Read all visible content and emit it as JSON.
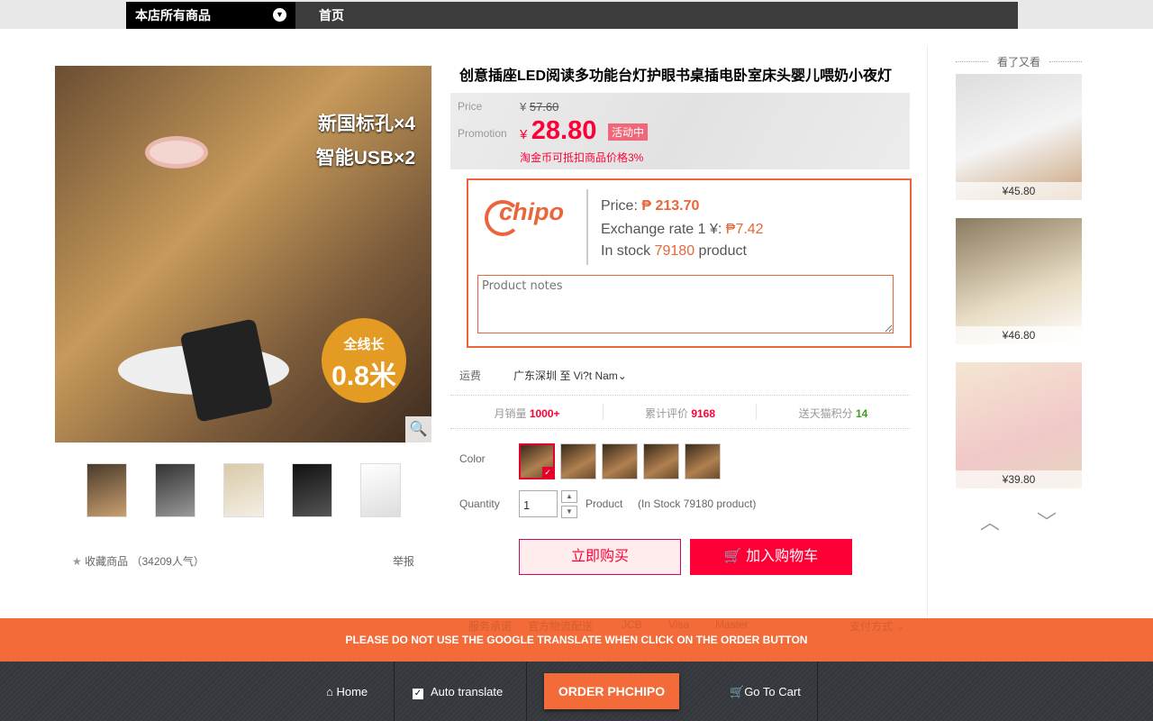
{
  "topnav": {
    "all_products": "本店所有商品",
    "home": "首页"
  },
  "gallery": {
    "overlay_line1": "新国标孔×4",
    "overlay_line2": "智能USB×2",
    "badge_line1": "全线长",
    "badge_line2": "0.8米",
    "thumbnail_count": 5
  },
  "favorite": {
    "label": "收藏商品",
    "popularity": "（34209人气）",
    "report": "举报"
  },
  "product": {
    "title": "创意插座LED阅读多功能台灯护眼书桌插电卧室床头婴儿喂奶小夜灯",
    "price_label": "Price",
    "currency": "¥",
    "original_price": "57.60",
    "promotion_label": "Promotion",
    "promotion_price": "28.80",
    "promo_tag": "活动中",
    "coin_note": "淘金币可抵扣商品价格3%"
  },
  "chipo": {
    "logo": "chipo",
    "price_label": "Price:",
    "price": "₱ 213.70",
    "rate_label": "Exchange rate 1 ¥:",
    "rate": "₱7.42",
    "stock_label": "In stock",
    "stock": "79180",
    "stock_unit": "product",
    "notes_placeholder": "Product notes"
  },
  "shipping": {
    "label": "运费",
    "value": "广东深圳  至 Vi?t Nam⌄"
  },
  "stats": [
    {
      "label": "月销量",
      "value": "1000+"
    },
    {
      "label": "累计评价",
      "value": "9168"
    },
    {
      "label": "送天猫积分",
      "value": "14"
    }
  ],
  "options": {
    "color_label": "Color",
    "color_count": 5,
    "selected_index": 0,
    "quantity_label": "Quantity",
    "quantity": "1",
    "unit": "Product",
    "stock_note": "(In Stock 79180 product)"
  },
  "actions": {
    "buy_now": "立即购买",
    "add_cart": "加入购物车"
  },
  "recommend": {
    "title": "看了又看",
    "items": [
      {
        "price": "¥45.80"
      },
      {
        "price": "¥46.80"
      },
      {
        "price": "¥39.80"
      }
    ]
  },
  "faint_footer": [
    "服务承诺",
    "官方物流配送",
    "JCB",
    "Visa",
    "Master",
    "支付方式 ⌄"
  ],
  "banner": {
    "warning": "PLEASE DO NOT USE THE GOOGLE TRANSLATE WHEN CLICK ON THE ORDER BUTTON"
  },
  "bottombar": {
    "home": "Home",
    "auto_translate": "Auto translate",
    "auto_translate_checked": true,
    "order": "ORDER PHCHIPO",
    "cart": "Go To Cart"
  },
  "colors": {
    "accent": "#ff0036",
    "chipo": "#f26b38",
    "dark": "#3a3d42"
  }
}
